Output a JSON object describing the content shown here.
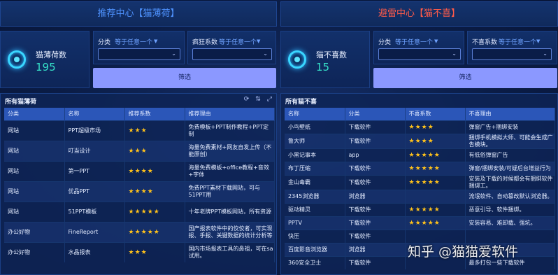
{
  "left": {
    "title": "推荐中心【猫薄荷】",
    "stat_label": "猫薄荷数",
    "stat_value": "195",
    "filter1": {
      "label": "分类",
      "option": "等于任意一个"
    },
    "filter2": {
      "label": "疯狂系数",
      "option": "等于任意一个"
    },
    "button": "筛选",
    "table_title": "所有猫薄荷",
    "columns": [
      "分类",
      "名称",
      "推荐系数",
      "推荐理由"
    ],
    "rows": [
      {
        "cat": "网站",
        "name": "PPT超级市场",
        "stars": "★★★",
        "reason": "免费模板+PPT制作教程+PPT定制"
      },
      {
        "cat": "网站",
        "name": "叮当设计",
        "stars": "★★★",
        "reason": "海量免费素材+网友自发上传（不能原创）"
      },
      {
        "cat": "网站",
        "name": "第一PPT",
        "stars": "★★★★",
        "reason": "海量免费模板+office教程+音效+字体"
      },
      {
        "cat": "网站",
        "name": "优品PPT",
        "stars": "★★★★",
        "reason": "免费PPT素材下载网站，可与51PPT用"
      },
      {
        "cat": "网站",
        "name": "51PPT模板",
        "stars": "★★★★★",
        "reason": "十年老牌PPT模板网站，所有资源"
      },
      {
        "cat": "办公好物",
        "name": "FineReport",
        "stars": "★★★★★",
        "reason": "国产报表软件中的佼佼者，可实现报、手报、关键数据的统计分析等"
      },
      {
        "cat": "办公好物",
        "name": "水晶报表",
        "stars": "★★★",
        "reason": "国内市场报表工具的鼻祖，可在sa试用。"
      }
    ]
  },
  "right": {
    "title": "避雷中心【猫不喜】",
    "stat_label": "猫不喜数",
    "stat_value": "15",
    "filter1": {
      "label": "分类",
      "option": "等于任意一个"
    },
    "filter2": {
      "label": "不喜系数",
      "option": "等于任意一个"
    },
    "button": "筛选",
    "table_title": "所有猫不喜",
    "columns": [
      "名称",
      "分类",
      "不喜系数",
      "不喜理由"
    ],
    "rows": [
      {
        "name": "小鸟壁纸",
        "cat": "下载软件",
        "stars": "★★★★",
        "reason": "弹窗广告+捆绑安装"
      },
      {
        "name": "鲁大师",
        "cat": "下载软件",
        "stars": "★★★★",
        "reason": "捆绑手机模拟大师、可能会生成广告模块。"
      },
      {
        "name": "小黑记事本",
        "cat": "app",
        "stars": "★★★★★",
        "reason": "有低俗弹窗广告"
      },
      {
        "name": "布丁压缩",
        "cat": "下载软件",
        "stars": "★★★★★",
        "reason": "弹窗/捆绑安装/可疑后台增益行为"
      },
      {
        "name": "金山毒霸",
        "cat": "下载软件",
        "stars": "★★★★★",
        "reason": "安装及下载的时候都会有捆绑软件捆绑工。"
      },
      {
        "name": "2345浏览器",
        "cat": "浏览器",
        "stars": "",
        "reason": "流氓软件、自动篡改默认浏览器。"
      },
      {
        "name": "驱动精灵",
        "cat": "下载软件",
        "stars": "★★★★★",
        "reason": "恶意引导、软件捆绑。"
      },
      {
        "name": "PPTV",
        "cat": "下载软件",
        "stars": "★★★★★",
        "reason": "安装容易、难卸载、强坑。"
      },
      {
        "name": "快压",
        "cat": "下载软件",
        "stars": "",
        "reason": ""
      },
      {
        "name": "百度影音浏览器",
        "cat": "浏览器",
        "stars": "",
        "reason": ""
      },
      {
        "name": "360安全卫士",
        "cat": "下载软件",
        "stars": "",
        "reason": "最多打包一些下载软件"
      }
    ]
  },
  "icons": [
    "refresh-icon",
    "sort-icon",
    "fullscreen-icon",
    "ring-icon"
  ],
  "watermark": "知乎 @猫猫爱软件",
  "colors": {
    "accent": "#8b98ff",
    "left_title": "#4f93ff",
    "right_title": "#ff5b4a",
    "stars": "#ffc21a",
    "value": "#36e0c8"
  }
}
